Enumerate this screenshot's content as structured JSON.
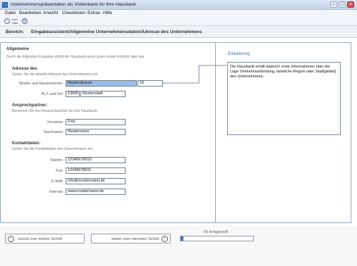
{
  "window": {
    "title": "Unternehmenspräsentation als Visitenkarte für Ihre Hausbank",
    "minimize": "–",
    "maximize": "□",
    "close": "×"
  },
  "menu": [
    "Datei",
    "Bearbeiten",
    "Ansicht",
    "Checklisten",
    "Extras",
    "Hilfe"
  ],
  "toolbar": {
    "back_icon": "back-arrow-icon",
    "home_line1": "zum",
    "home_line2": "Start",
    "globe_icon": "globe-icon"
  },
  "bereich": {
    "label": "Bereich:",
    "value": "Eingabeassistent/Allgemeine Unternehmensdaten/Adresse des Unternehmens"
  },
  "form": {
    "heading": "Allgemeine",
    "intro": "Durch die folgenden Eingaben erhält die Hausbank einen guten ersten Einblick über das",
    "address": {
      "title": "Adresse des",
      "hint": "Geben Sie die aktuelle Adresse des Unternehmens ein.",
      "street_label": "Straße und Hausnummer:",
      "street_value": "Musterstrasse",
      "house_number": "10",
      "city_label": "PLZ und Ort:",
      "zip_value": "13000",
      "city_value": "Musterstadt"
    },
    "contact_person": {
      "title": "Ansprechpartner:",
      "hint": "Benennen Sie den Ansprechpartner für Ihre Hausbank.",
      "firstname_label": "Vorname:",
      "firstname_value": "Fritz",
      "lastname_label": "Nachname:",
      "lastname_value": "Mustermann"
    },
    "contact_data": {
      "title": "Kontaktdaten:",
      "hint": "Geben Sie die Kontaktdaten des Unternehmens ein.",
      "phone_label": "Telefon:",
      "phone_value": "12345678910",
      "fax_label": "Fax:",
      "fax_value": "12345678911",
      "email_label": "E-Mail:",
      "email_value": "info@mustermann.de",
      "web_label": "Internet:",
      "web_value": "www.mustermann.de"
    }
  },
  "info": {
    "title": "Erläuterung",
    "text": "Die Hausbank erhält dadurch erste Informationen über die Lage (Verkehrsanbindung, ländliche Region oder Stadtgebiet) des Unternehmens."
  },
  "footer": {
    "back_label": "zurück zum letzten Schritt",
    "back_icon": "‹",
    "next_label": "weiter zum nächsten Schritt",
    "next_icon": "›",
    "progress_label": "0% fertiggestellt",
    "progress_fraction": 0.04
  },
  "colors": {
    "accent": "#3c6fb0",
    "selection": "#9cbde6",
    "progress": "#4a78bd"
  }
}
